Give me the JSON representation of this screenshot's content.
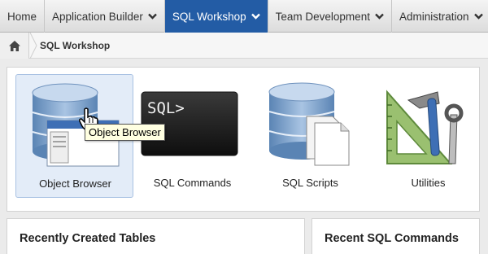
{
  "nav": {
    "tabs": [
      {
        "label": "Home",
        "has_menu": false,
        "active": false
      },
      {
        "label": "Application Builder",
        "has_menu": true,
        "active": false
      },
      {
        "label": "SQL Workshop",
        "has_menu": true,
        "active": true
      },
      {
        "label": "Team Development",
        "has_menu": true,
        "active": false
      },
      {
        "label": "Administration",
        "has_menu": true,
        "active": false
      }
    ],
    "active_color": "#235ca5"
  },
  "breadcrumb": {
    "icon": "home-icon",
    "current": "SQL Workshop"
  },
  "tiles": [
    {
      "label": "Object Browser",
      "icon": "object-browser-icon",
      "selected": true
    },
    {
      "label": "SQL Commands",
      "icon": "sql-commands-icon",
      "selected": false
    },
    {
      "label": "SQL Scripts",
      "icon": "sql-scripts-icon",
      "selected": false
    },
    {
      "label": "Utilities",
      "icon": "utilities-icon",
      "selected": false
    }
  ],
  "sql_icon_text": "SQL>",
  "tooltip": "Object Browser",
  "cards": [
    {
      "title": "Recently Created Tables"
    },
    {
      "title": "Recent SQL Commands"
    }
  ]
}
